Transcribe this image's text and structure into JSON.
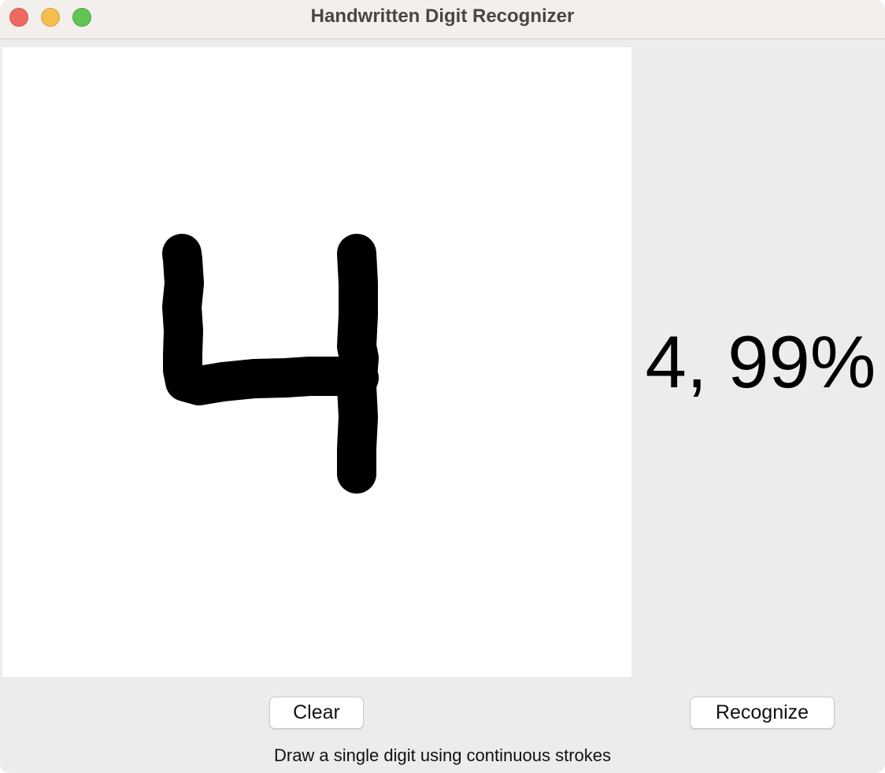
{
  "window": {
    "title": "Handwritten Digit Recognizer"
  },
  "prediction": {
    "result_text": "4, 99%"
  },
  "buttons": {
    "clear_label": "Clear",
    "recognize_label": "Recognize"
  },
  "status": {
    "instruction": "Draw a single digit using continuous strokes"
  },
  "colors": {
    "canvas_background": "#ffffff",
    "stroke": "#000000",
    "window_background": "#ececec",
    "close": "#ee6a5f",
    "minimize": "#f5bf4f",
    "zoom": "#61c454"
  }
}
